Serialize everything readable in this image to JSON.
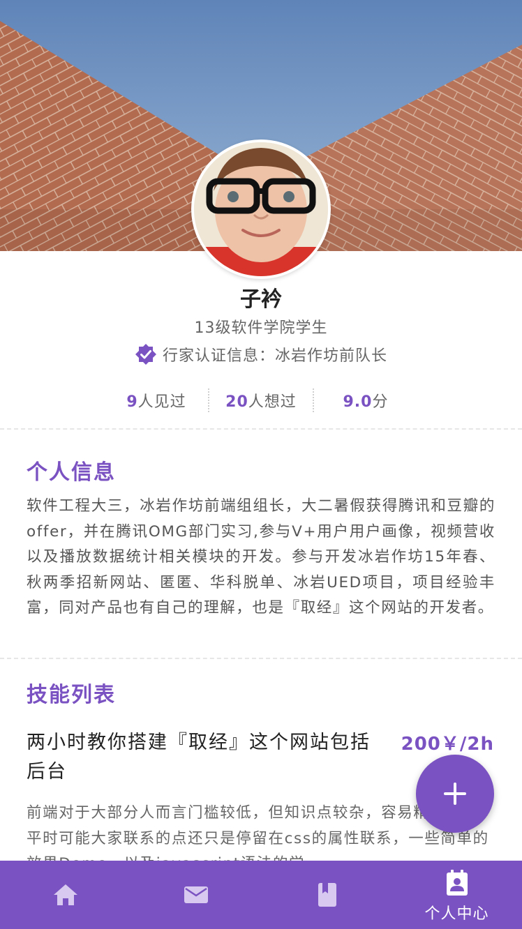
{
  "profile": {
    "name": "子衿",
    "subtitle": "13级软件学院学生",
    "verification": "行家认证信息：冰岩作坊前队长"
  },
  "stats": [
    {
      "num": "9",
      "suffix": "人见过"
    },
    {
      "num": "20",
      "suffix": "人想过"
    },
    {
      "num": "9.0",
      "suffix": "分"
    }
  ],
  "personal_info": {
    "title": "个人信息",
    "content": "软件工程大三，冰岩作坊前端组组长，大二暑假获得腾讯和豆瓣的offer，并在腾讯OMG部门实习,参与V+用户用户画像，视频营收以及播放数据统计相关模块的开发。参与开发冰岩作坊15年春、秋两季招新网站、匿匿、华科脱单、冰岩UED项目，项目经验丰富，同对产品也有自己的理解，也是『取经』这个网站的开发者。"
  },
  "skills": {
    "title": "技能列表",
    "items": [
      {
        "title": "两小时教你搭建『取经』这个网站包括后台",
        "price": "200￥/2h",
        "description": "前端对于大部分人而言门槛较低，但知识点较杂，容易精通很难，平时可能大家联系的点还只是停留在css的属性联系，一些简单的效果Demo，以及javascript语法的学"
      }
    ]
  },
  "tabbar": {
    "tabs": [
      {
        "icon": "home-icon",
        "label": ""
      },
      {
        "icon": "mail-icon",
        "label": ""
      },
      {
        "icon": "book-icon",
        "label": ""
      },
      {
        "icon": "profile-card-icon",
        "label": "个人中心",
        "active": true
      }
    ]
  },
  "colors": {
    "accent": "#7b52c1",
    "text_primary": "#222222",
    "text_secondary": "#666666"
  }
}
